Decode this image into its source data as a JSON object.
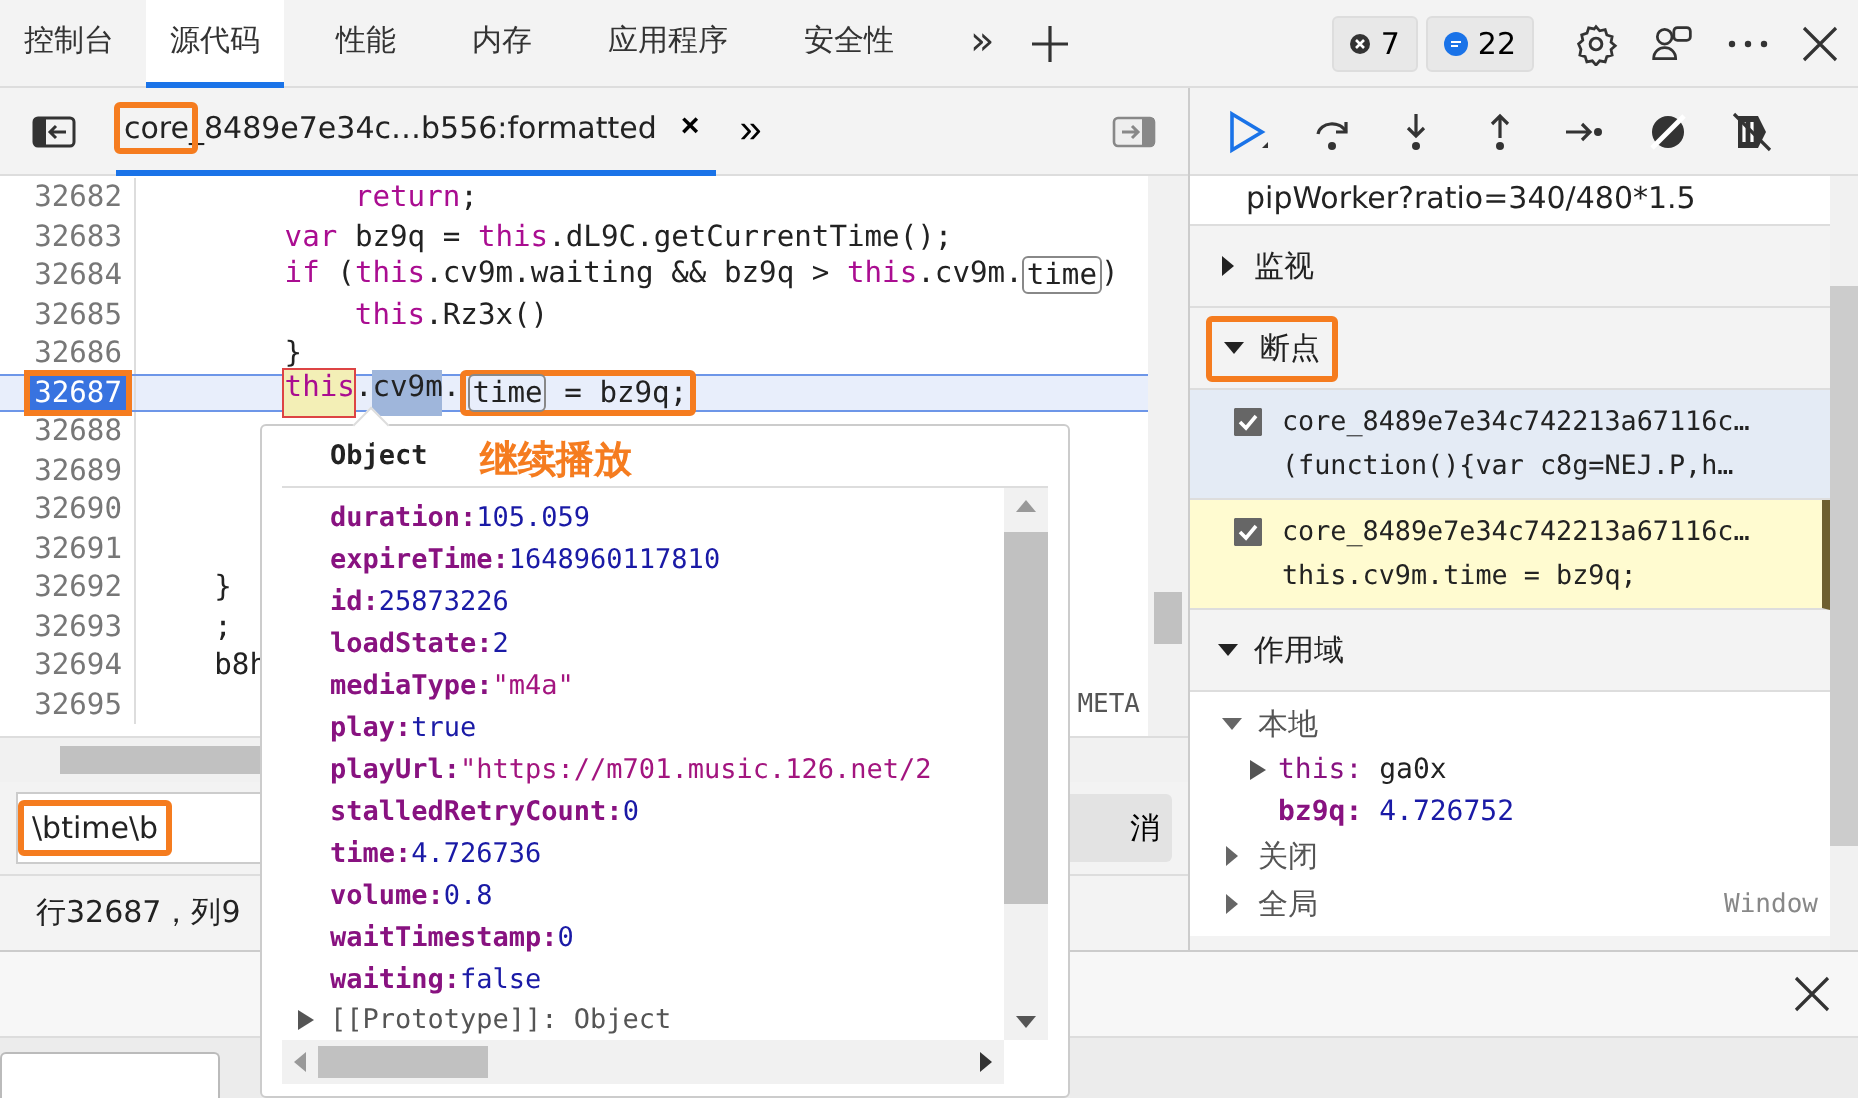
{
  "tabs": [
    {
      "label": "控制台",
      "selected": false
    },
    {
      "label": "源代码",
      "selected": true
    },
    {
      "label": "性能",
      "selected": false
    },
    {
      "label": "内存",
      "selected": false
    },
    {
      "label": "应用程序",
      "selected": false
    },
    {
      "label": "安全性",
      "selected": false
    }
  ],
  "tab_overflow": "»",
  "issue_badges": [
    {
      "kind": "error",
      "count": "7"
    },
    {
      "kind": "message",
      "count": "22"
    }
  ],
  "file_tab": {
    "name": "core_8489e7e34c…b556:formatted",
    "close": "×",
    "prefix_highlighted": true
  },
  "file_tab_overflow": "»",
  "code_lines": [
    {
      "number": "32682",
      "current": false,
      "tokens": [
        {
          "text": "            return",
          "kind": "keyword"
        },
        {
          "text": ";"
        }
      ]
    },
    {
      "number": "32683",
      "current": false,
      "tokens": [
        {
          "text": "        var",
          "kind": "keyword"
        },
        {
          "text": " bz9q = "
        },
        {
          "text": "this",
          "kind": "keyword"
        },
        {
          "text": ".dL9C.getCurrentTime();"
        }
      ]
    },
    {
      "number": "32684",
      "current": false,
      "tokens": [
        {
          "text": "        if",
          "kind": "keyword"
        },
        {
          "text": " ("
        },
        {
          "text": "this",
          "kind": "keyword"
        },
        {
          "text": ".cv9m.waiting && bz9q > "
        },
        {
          "text": "this",
          "kind": "keyword"
        },
        {
          "text": ".cv9m."
        },
        {
          "text": "time",
          "kind": "boxed"
        },
        {
          "text": ")"
        }
      ]
    },
    {
      "number": "32685",
      "current": false,
      "tokens": [
        {
          "text": "            this",
          "kind": "keyword"
        },
        {
          "text": ".Rz3x()"
        }
      ]
    },
    {
      "number": "32686",
      "current": false,
      "tokens": [
        {
          "text": "        }"
        }
      ]
    },
    {
      "number": "32687",
      "current": true,
      "tokens": [
        {
          "text": "this",
          "kind": "marked"
        },
        {
          "text": "."
        },
        {
          "text": "cv9m",
          "kind": "selection"
        },
        {
          "text": "."
        },
        {
          "text": "time",
          "kind": "boxed",
          "annotated": true
        },
        {
          "text": " = bz9q;",
          "annotated": true
        }
      ]
    },
    {
      "number": "32688",
      "current": false
    },
    {
      "number": "32689",
      "current": false
    },
    {
      "number": "32690",
      "current": false
    },
    {
      "number": "32691",
      "current": false
    },
    {
      "number": "32692",
      "current": false,
      "tokens": [
        {
          "text": "    }"
        }
      ]
    },
    {
      "number": "32693",
      "current": false,
      "tokens": [
        {
          "text": "    ;"
        }
      ]
    },
    {
      "number": "32694",
      "current": false,
      "tokens": [
        {
          "text": "    b8h"
        }
      ]
    },
    {
      "number": "32695",
      "current": false
    }
  ],
  "autocomplete_hint": "META",
  "popover": {
    "title": "Object",
    "properties": [
      {
        "key": "duration:",
        "value": "105.059",
        "kind": "number"
      },
      {
        "key": "expireTime:",
        "value": "1648960117810",
        "kind": "number"
      },
      {
        "key": "id:",
        "value": "25873226",
        "kind": "number"
      },
      {
        "key": "loadState:",
        "value": "2",
        "kind": "number"
      },
      {
        "key": "mediaType:",
        "value": "\"m4a\"",
        "kind": "string"
      },
      {
        "key": "play:",
        "value": "true",
        "kind": "number"
      },
      {
        "key": "playUrl:",
        "value": "\"https://m701.music.126.net/2",
        "kind": "string"
      },
      {
        "key": "stalledRetryCount:",
        "value": "0",
        "kind": "number"
      },
      {
        "key": "time:",
        "value": "4.726736",
        "kind": "number"
      },
      {
        "key": "volume:",
        "value": "0.8",
        "kind": "number"
      },
      {
        "key": "waitTimestamp:",
        "value": "0",
        "kind": "number"
      },
      {
        "key": "waiting:",
        "value": "false",
        "kind": "number"
      }
    ],
    "prototype": {
      "key": "[[Prototype]]:",
      "value": "Object"
    }
  },
  "annotation_label": "继续播放",
  "search": {
    "value": "\\btime\\b",
    "highlighted": true
  },
  "cancel_button": "消",
  "status": "行32687，列9",
  "call_stack_tail": "pipWorker?ratio=340/480*1.5",
  "sections": [
    {
      "title": "监视",
      "expanded": false,
      "highlighted": false
    },
    {
      "title": "断点",
      "expanded": true,
      "highlighted": true,
      "breakpoints": [
        {
          "file": "core_8489e7e34c742213a67116c…",
          "code": "(function(){var c8g=NEJ.P,h…",
          "checked": true,
          "selected": true,
          "paused": false
        },
        {
          "file": "core_8489e7e34c742213a67116c…",
          "code": "this.cv9m.time = bz9q;",
          "checked": true,
          "selected": false,
          "paused": true
        }
      ]
    },
    {
      "title": "作用域",
      "expanded": true,
      "highlighted": false,
      "scopes": [
        {
          "name": "本地",
          "expanded": true,
          "variables": [
            {
              "name": "this:",
              "value": "ga0x",
              "kind": "object"
            },
            {
              "name": "bz9q:",
              "value": "4.726752",
              "kind": "number"
            }
          ]
        },
        {
          "name": "关闭",
          "expanded": false
        },
        {
          "name": "全局",
          "expanded": false,
          "value": "Window"
        }
      ]
    }
  ]
}
